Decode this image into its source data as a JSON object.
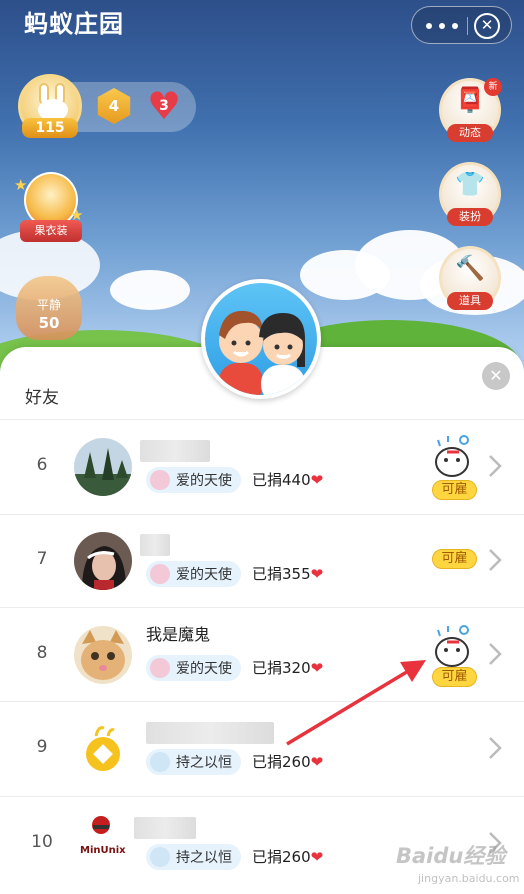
{
  "header": {
    "title": "蚂蚁庄园",
    "more_icon": "more-dots-icon",
    "close_icon": "close-circle-icon"
  },
  "game": {
    "level": "115",
    "badge_hex": "4",
    "badge_heart": "3",
    "fruit_clothes_label": "果衣装",
    "calm_label": "平静",
    "calm_value": "50",
    "right_buttons": [
      {
        "label": "动态",
        "icon": "mailbox-icon",
        "badge": "新"
      },
      {
        "label": "装扮",
        "icon": "shirt-icon"
      },
      {
        "label": "道具",
        "icon": "hammer-icon"
      }
    ]
  },
  "friends": {
    "section_title": "好友",
    "close_icon": "close-icon",
    "hire_label": "可雇",
    "rows": [
      {
        "rank": "6",
        "name": "",
        "tag": "爱的天使",
        "donated": "已捐440",
        "hire": true,
        "mascot": true
      },
      {
        "rank": "7",
        "name": "",
        "tag": "爱的天使",
        "donated": "已捐355",
        "hire": true,
        "mascot": false
      },
      {
        "rank": "8",
        "name": "我是魔鬼",
        "tag": "爱的天使",
        "donated": "已捐320",
        "hire": true,
        "mascot": true
      },
      {
        "rank": "9",
        "name": "",
        "tag": "持之以恒",
        "donated": "已捐260",
        "hire": false,
        "mascot": false
      },
      {
        "rank": "10",
        "name": "",
        "avatar_text": "MinUnix",
        "tag": "持之以恒",
        "donated": "已捐260",
        "hire": false,
        "mascot": false
      }
    ]
  },
  "watermark": {
    "text": "Baidu经验",
    "sub": "jingyan.baidu.com"
  },
  "colors": {
    "accent_red": "#e8333e",
    "hire_yellow": "#ffd640",
    "tag_bg": "#e6f2fc"
  }
}
